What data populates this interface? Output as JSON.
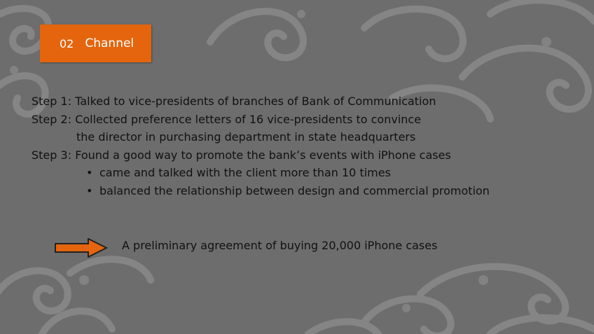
{
  "section": {
    "number": "02",
    "title": "Channel"
  },
  "steps": [
    {
      "label": "Step 1:",
      "text": "Talked to vice-presidents of branches of Bank of Communication"
    },
    {
      "label": "Step 2:",
      "text": "Collected  preference letters of 16 vice-presidents to convince",
      "continuation": "the director in purchasing department in state headquarters"
    },
    {
      "label": "Step 3:",
      "text": "Found a good way to promote the bank’s events with iPhone cases",
      "bullets": [
        "came and talked with the client more than 10 times",
        "balanced the relationship between design and commercial promotion"
      ]
    }
  ],
  "result": {
    "text": "A preliminary agreement of buying 20,000 iPhone cases"
  },
  "colors": {
    "background": "#6d6d6d",
    "accent": "#e4650e",
    "ornament": "#8c8c8c",
    "text": "#111111"
  },
  "icons": {
    "result_arrow": "right-arrow-icon",
    "bullet": "bullet-dot"
  }
}
